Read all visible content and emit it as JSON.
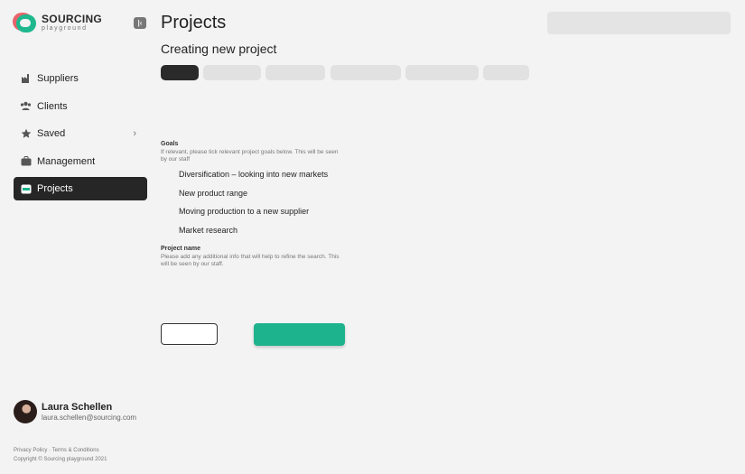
{
  "brand": {
    "name": "SOURCING",
    "sub": "playground",
    "colors": {
      "primary": "#1db38c",
      "secondary": "#e8636a"
    }
  },
  "sidebar": {
    "collapse_icon": "collapse-left-icon",
    "items": [
      {
        "label": "Suppliers",
        "icon": "factory-icon"
      },
      {
        "label": "Clients",
        "icon": "users-icon"
      },
      {
        "label": "Saved",
        "icon": "star-icon",
        "chevron": "›"
      },
      {
        "label": "Management",
        "icon": "briefcase-icon"
      },
      {
        "label": "Projects",
        "icon": "folder-icon",
        "active": true
      }
    ]
  },
  "user": {
    "name": "Laura Schellen",
    "email": "laura.schellen@sourcing.com"
  },
  "footer": {
    "links": "Privacy Policy · Terms & Conditions",
    "copyright": "Copyright © Sourcing playground 2021"
  },
  "page": {
    "title": "Projects",
    "subtitle": "Creating new project"
  },
  "steps": {
    "count": 6,
    "active_index": 0
  },
  "goals": {
    "heading": "Goals",
    "description": "If relevant, please tick relevant project goals below. This will be seen by our staff",
    "items": [
      "Diversification – looking into new markets",
      "New product range",
      "Moving production to a new supplier",
      "Market research"
    ]
  },
  "project_name": {
    "heading": "Project name",
    "description": "Please add any additional info that will help to refine the search. This will be seen by our staff."
  },
  "colors": {
    "active_nav": "#262626",
    "next_button": "#1db38c",
    "background": "#f3f3f3"
  }
}
